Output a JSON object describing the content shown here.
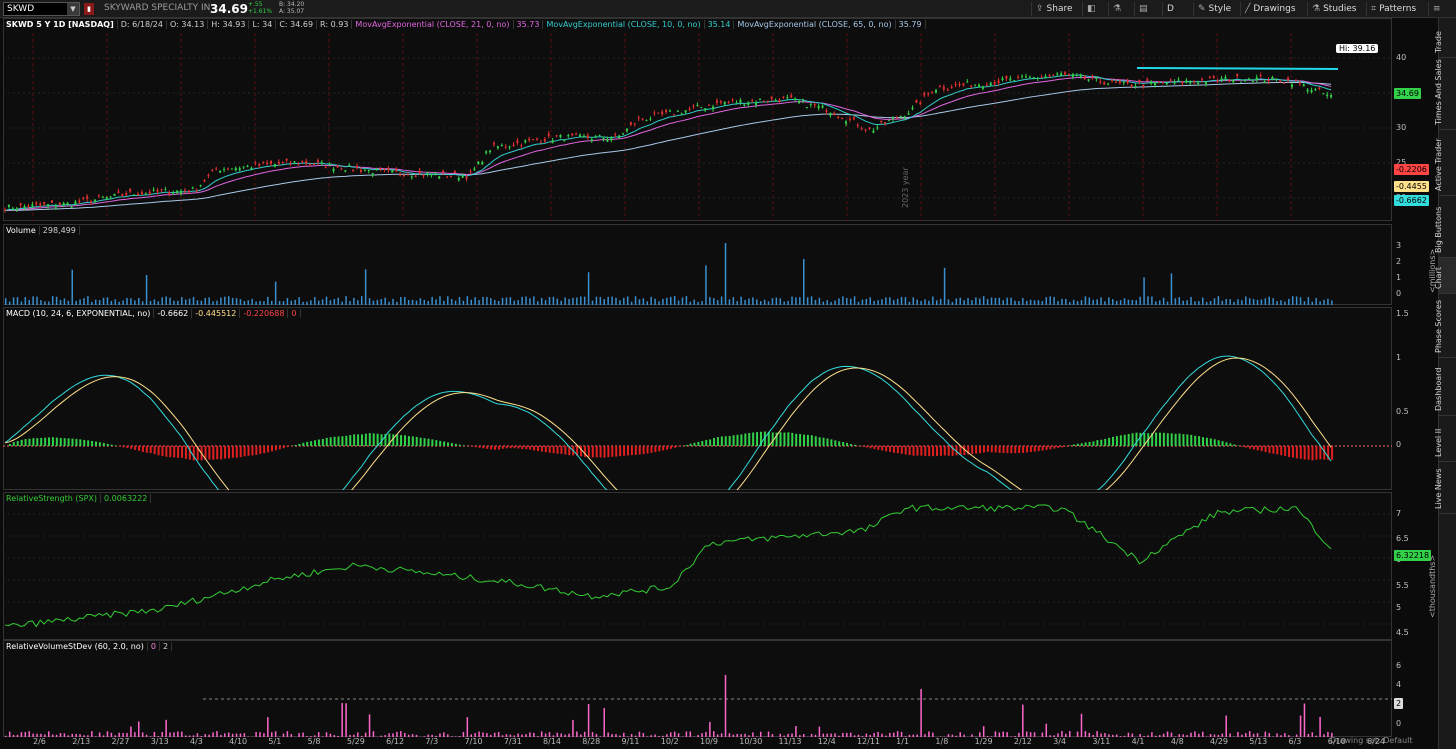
{
  "toolbar": {
    "symbol": "SKWD",
    "company": "SKYWARD SPECIALTY IN",
    "last": "34.69",
    "change": "+.55",
    "change_pct": "+1.61%",
    "bid": "B: 34.20",
    "ask": "A: 35.07",
    "buttons": {
      "share": "Share",
      "period": "D",
      "style": "Style",
      "drawings": "Drawings",
      "studies": "Studies",
      "patterns": "Patterns"
    }
  },
  "price_pane": {
    "header": "SKWD 5 Y 1D [NASDAQ]",
    "ohlc": {
      "d": "D: 6/18/24",
      "o": "O: 34.13",
      "h": "H: 34.93",
      "l": "L: 34",
      "c": "C: 34.69",
      "r": "R: 0.93"
    },
    "studies": [
      {
        "label": "MovAvgExponential (CLOSE, 21, 0, no)",
        "value": "35.73",
        "color": "#e066e0"
      },
      {
        "label": "MovAvgExponential (CLOSE, 10, 0, no)",
        "value": "35.14",
        "color": "#33cccc"
      },
      {
        "label": "MovAvgExponential (CLOSE, 65, 0, no)",
        "value": "35.79",
        "color": "#a8c8e8"
      }
    ],
    "hi_label": "Hi: 39.16",
    "last_tag": "34.69",
    "year_marker": "2023 year",
    "axis_ticks": [
      "40",
      "35",
      "30",
      "25",
      "20"
    ]
  },
  "volume_pane": {
    "header": "Volume",
    "value": "298,499",
    "axis_ticks": [
      "3",
      "2",
      "1",
      "0"
    ],
    "unit": "<millions>"
  },
  "macd_pane": {
    "header": "MACD (10, 24, 6, EXPONENTIAL, no)",
    "values": [
      "-0.6662",
      "-0.445512",
      "-0.220688",
      "0"
    ],
    "axis_ticks": [
      "1.5",
      "1",
      "0.5",
      "0"
    ],
    "tags": [
      {
        "text": "-0.2206",
        "color": "#ff4444"
      },
      {
        "text": "-0.4455",
        "color": "#ffe08a"
      },
      {
        "text": "-0.6662",
        "color": "#33dddd"
      }
    ]
  },
  "rs_pane": {
    "header": "RelativeStrength (SPX)",
    "value": "0.0063222",
    "axis_ticks": [
      "7",
      "6.5",
      "6",
      "5.5",
      "5",
      "4.5"
    ],
    "tag": "6.32218",
    "unit": "<thousandths>"
  },
  "rvsd_pane": {
    "header": "RelativeVolumeStDev (60, 2.0, no)",
    "values": [
      "0",
      "2"
    ],
    "axis_ticks": [
      "6",
      "4",
      "2",
      "0"
    ],
    "tag": "2"
  },
  "date_axis": [
    "2/6",
    "2/13",
    "2/27",
    "3/13",
    "4/3",
    "4/10",
    "5/1",
    "5/8",
    "5/29",
    "6/12",
    "7/3",
    "7/10",
    "7/31",
    "8/14",
    "8/28",
    "9/11",
    "10/2",
    "10/9",
    "10/30",
    "11/13",
    "12/4",
    "12/11",
    "1/1",
    "1/8",
    "1/29",
    "2/12",
    "3/4",
    "3/11",
    "4/1",
    "4/8",
    "4/29",
    "5/13",
    "6/3",
    "6/10",
    "6/24"
  ],
  "footer": "Drawing set: Default",
  "sidebar": [
    "Trade",
    "Times And Sales",
    "Active Trader",
    "Big Buttons",
    "Chart",
    "Phase Scores",
    "Dashboard",
    "Level II",
    "Live News"
  ]
}
